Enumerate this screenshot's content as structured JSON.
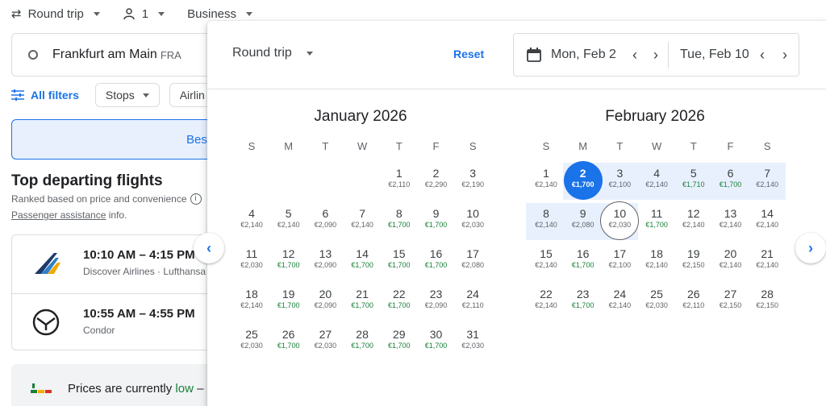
{
  "search": {
    "trip_type": "Round trip",
    "passengers": "1",
    "cabin": "Business",
    "origin_city": "Frankfurt am Main",
    "origin_code": "FRA",
    "all_filters": "All filters",
    "stops": "Stops",
    "airlines_partial": "Airlin",
    "best_partial": "Bes"
  },
  "results": {
    "heading": "Top departing flights",
    "ranked": "Ranked based on price and convenience",
    "assist_link": "Passenger assistance",
    "assist_suffix": "info.",
    "flights": [
      {
        "time": "10:10 AM – 4:15 PM",
        "airline": "Discover Airlines · Lufthansa"
      },
      {
        "time": "10:55 AM – 4:55 PM",
        "airline": "Condor"
      }
    ],
    "prices_prefix": "Prices are currently",
    "prices_level": "low",
    "prices_suffix": "–"
  },
  "calendar": {
    "trip_type": "Round trip",
    "reset": "Reset",
    "depart": "Mon, Feb 2",
    "return": "Tue, Feb 10",
    "weekdays": [
      "S",
      "M",
      "T",
      "W",
      "T",
      "F",
      "S"
    ],
    "months": [
      {
        "title": "January 2026",
        "days": [
          {
            "d": "1",
            "p": "€2,110",
            "g": false
          },
          {
            "d": "2",
            "p": "€2,290",
            "g": false
          },
          {
            "d": "3",
            "p": "€2,190",
            "g": false
          },
          {
            "d": "4",
            "p": "€2,140",
            "g": false
          },
          {
            "d": "5",
            "p": "€2,140",
            "g": false
          },
          {
            "d": "6",
            "p": "€2,090",
            "g": false
          },
          {
            "d": "7",
            "p": "€2,140",
            "g": false
          },
          {
            "d": "8",
            "p": "€1,700",
            "g": true
          },
          {
            "d": "9",
            "p": "€1,700",
            "g": true
          },
          {
            "d": "10",
            "p": "€2,030",
            "g": false
          },
          {
            "d": "11",
            "p": "€2,030",
            "g": false
          },
          {
            "d": "12",
            "p": "€1,700",
            "g": true
          },
          {
            "d": "13",
            "p": "€2,090",
            "g": false
          },
          {
            "d": "14",
            "p": "€1,700",
            "g": true
          },
          {
            "d": "15",
            "p": "€1,700",
            "g": true
          },
          {
            "d": "16",
            "p": "€1,700",
            "g": true
          },
          {
            "d": "17",
            "p": "€2,080",
            "g": false
          },
          {
            "d": "18",
            "p": "€2,140",
            "g": false
          },
          {
            "d": "19",
            "p": "€1,700",
            "g": true
          },
          {
            "d": "20",
            "p": "€2,090",
            "g": false
          },
          {
            "d": "21",
            "p": "€1,700",
            "g": true
          },
          {
            "d": "22",
            "p": "€1,700",
            "g": true
          },
          {
            "d": "23",
            "p": "€2,090",
            "g": false
          },
          {
            "d": "24",
            "p": "€2,110",
            "g": false
          },
          {
            "d": "25",
            "p": "€2,030",
            "g": false
          },
          {
            "d": "26",
            "p": "€1,700",
            "g": true
          },
          {
            "d": "27",
            "p": "€2,030",
            "g": false
          },
          {
            "d": "28",
            "p": "€1,700",
            "g": true
          },
          {
            "d": "29",
            "p": "€1,700",
            "g": true
          },
          {
            "d": "30",
            "p": "€1,700",
            "g": true
          },
          {
            "d": "31",
            "p": "€2,030",
            "g": false
          }
        ]
      },
      {
        "title": "February 2026",
        "days": [
          {
            "d": "1",
            "p": "€2,140",
            "g": false
          },
          {
            "d": "2",
            "p": "€1,700",
            "g": false
          },
          {
            "d": "3",
            "p": "€2,100",
            "g": false
          },
          {
            "d": "4",
            "p": "€2,140",
            "g": false
          },
          {
            "d": "5",
            "p": "€1,710",
            "g": true
          },
          {
            "d": "6",
            "p": "€1,700",
            "g": true
          },
          {
            "d": "7",
            "p": "€2,140",
            "g": false
          },
          {
            "d": "8",
            "p": "€2,140",
            "g": false
          },
          {
            "d": "9",
            "p": "€2,080",
            "g": false
          },
          {
            "d": "10",
            "p": "€2,030",
            "g": false
          },
          {
            "d": "11",
            "p": "€1,700",
            "g": true
          },
          {
            "d": "12",
            "p": "€2,140",
            "g": false
          },
          {
            "d": "13",
            "p": "€2,140",
            "g": false
          },
          {
            "d": "14",
            "p": "€2,140",
            "g": false
          },
          {
            "d": "15",
            "p": "€2,140",
            "g": false
          },
          {
            "d": "16",
            "p": "€1,700",
            "g": true
          },
          {
            "d": "17",
            "p": "€2,100",
            "g": false
          },
          {
            "d": "18",
            "p": "€2,140",
            "g": false
          },
          {
            "d": "19",
            "p": "€2,150",
            "g": false
          },
          {
            "d": "20",
            "p": "€2,140",
            "g": false
          },
          {
            "d": "21",
            "p": "€2,140",
            "g": false
          },
          {
            "d": "22",
            "p": "€2,140",
            "g": false
          },
          {
            "d": "23",
            "p": "€1,700",
            "g": true
          },
          {
            "d": "24",
            "p": "€2,140",
            "g": false
          },
          {
            "d": "25",
            "p": "€2,030",
            "g": false
          },
          {
            "d": "26",
            "p": "€2,110",
            "g": false
          },
          {
            "d": "27",
            "p": "€2,150",
            "g": false
          },
          {
            "d": "28",
            "p": "€2,150",
            "g": false
          }
        ]
      }
    ]
  }
}
